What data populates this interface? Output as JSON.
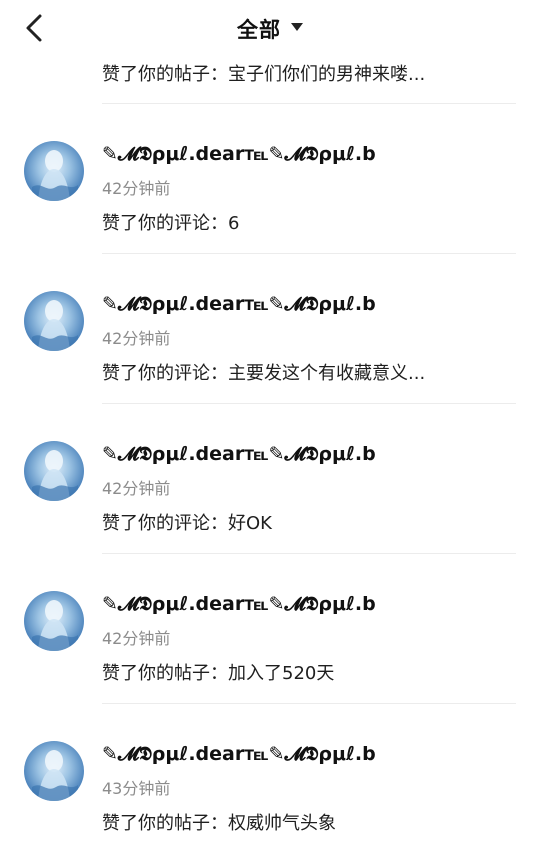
{
  "header": {
    "title": "全部",
    "back_icon": "chevron-left-icon",
    "dropdown_icon": "caret-down-icon"
  },
  "top_partial": {
    "action": "赞了你的帖子：宝子们你们的男神来喽..."
  },
  "notifications": [
    {
      "name": "✎𝓜𝕯ρμℓ.dear℡✎𝓜𝕯ρμℓ.b",
      "time": "42分钟前",
      "action": "赞了你的评论：6"
    },
    {
      "name": "✎𝓜𝕯ρμℓ.dear℡✎𝓜𝕯ρμℓ.b",
      "time": "42分钟前",
      "action": "赞了你的评论：主要发这个有收藏意义..."
    },
    {
      "name": "✎𝓜𝕯ρμℓ.dear℡✎𝓜𝕯ρμℓ.b",
      "time": "42分钟前",
      "action": "赞了你的评论：好OK"
    },
    {
      "name": "✎𝓜𝕯ρμℓ.dear℡✎𝓜𝕯ρμℓ.b",
      "time": "42分钟前",
      "action": "赞了你的帖子：加入了520天"
    },
    {
      "name": "✎𝓜𝕯ρμℓ.dear℡✎𝓜𝕯ρμℓ.b",
      "time": "43分钟前",
      "action": "赞了你的帖子：权威帅气头象"
    }
  ]
}
